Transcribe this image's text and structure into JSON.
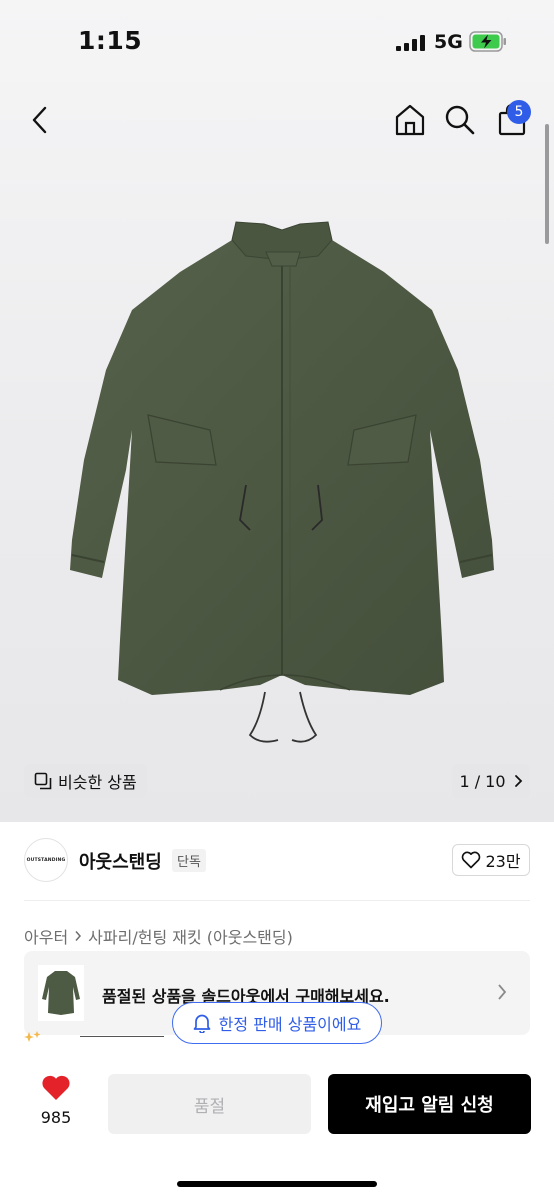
{
  "status_bar": {
    "time": "1:15",
    "network": "5G"
  },
  "nav": {
    "cart_count": "5"
  },
  "gallery": {
    "similar_label": "비슷한 상품",
    "page_indicator": "1 / 10"
  },
  "brand": {
    "logo_text": "OUTSTANDING",
    "name": "아웃스탠딩",
    "tag": "단독",
    "likes": "23만"
  },
  "breadcrumb": {
    "items": [
      "아우터",
      "사파리/헌팅 재킷 (아웃스탠딩)"
    ]
  },
  "soldout_banner": {
    "text": "품절된 상품을 솔드아웃에서 구매해보세요."
  },
  "limited_pill": {
    "text": "한정 판매 상품이에요"
  },
  "bottom_bar": {
    "favorite_count": "985",
    "soldout_label": "품절",
    "restock_label": "재입고 알림 신청"
  },
  "colors": {
    "accent_blue": "#2f5de8",
    "heart_red": "#e4222a",
    "jacket_green": "#4d5a44"
  }
}
